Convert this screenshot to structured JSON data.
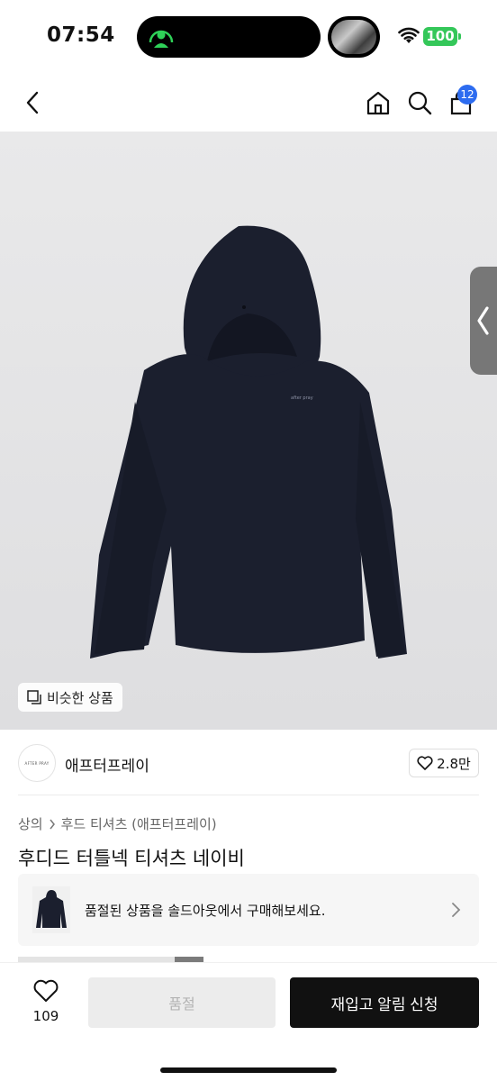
{
  "status_bar": {
    "time": "07:54",
    "battery": "100",
    "icons": [
      "call-activity-icon",
      "wifi-icon",
      "battery-icon"
    ]
  },
  "nav": {
    "cart_count": "12",
    "icons": [
      "back-icon",
      "home-icon",
      "search-icon",
      "cart-icon"
    ]
  },
  "product_image": {
    "print_text": "after pray",
    "similar_label": "비슷한 상품"
  },
  "brand": {
    "logo_text": "AFTER PRAY",
    "name": "애프터프레이",
    "likes": "2.8만"
  },
  "breadcrumb": {
    "items": [
      "상의",
      "후드 티셔츠 (애프터프레이)"
    ]
  },
  "product": {
    "title": "후디드 터틀넥 티셔츠 네이비"
  },
  "soldout_banner": {
    "text": "품절된 상품을 솔드아웃에서 구매해보세요."
  },
  "bottom_bar": {
    "wish_count": "109",
    "soldout_label": "품절",
    "restock_label": "재입고 알림 신청"
  },
  "colors": {
    "accent_badge": "#2d6cf0",
    "battery": "#34c759",
    "hoodie": "#1b1f2e",
    "primary_button": "#111111"
  }
}
